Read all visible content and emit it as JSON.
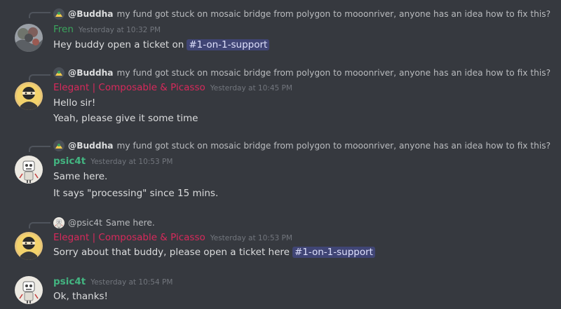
{
  "messages": [
    {
      "reply_to": "@Buddha",
      "reply_text": "my fund got stuck on mosaic bridge from polygon to mooonriver, anyone has an idea how to fix this?",
      "author": "Fren",
      "timestamp": "Yesterday at 10:32 PM",
      "lines": [
        "Hey buddy open a ticket on"
      ],
      "channel": "#1-on-1-support"
    },
    {
      "reply_to": "@Buddha",
      "reply_text": "my fund got stuck on mosaic bridge from polygon to mooonriver, anyone has an idea how to fix this?",
      "author": "Elegant | Composable & Picasso",
      "timestamp": "Yesterday at 10:45 PM",
      "lines": [
        "Hello sir!",
        "Yeah, please give it some time"
      ]
    },
    {
      "reply_to": "@Buddha",
      "reply_text": "my fund got stuck on mosaic bridge from polygon to mooonriver, anyone has an idea how to fix this?",
      "author": "psic4t",
      "timestamp": "Yesterday at 10:53 PM",
      "lines": [
        "Same here.",
        "It says \"processing\" since 15 mins."
      ]
    },
    {
      "reply_to": "@psic4t",
      "reply_text": "Same here.",
      "author": "Elegant | Composable & Picasso",
      "timestamp": "Yesterday at 10:53 PM",
      "lines": [
        "Sorry about that buddy, please open a ticket here"
      ],
      "channel": "#1-on-1-support"
    },
    {
      "author": "psic4t",
      "timestamp": "Yesterday at 10:54 PM",
      "lines": [
        "Ok, thanks!"
      ]
    }
  ],
  "colors": {
    "background": "#36393f",
    "fren": "#3ba55d",
    "elegant": "#d8295b",
    "psic4t": "#43b581",
    "mention_bg": "#3c4270"
  },
  "icons": {
    "reply_avatar": "avatar-icon",
    "fren_avatar": "tree-avatar",
    "elegant_avatar": "ninja-avatar",
    "psic4t_avatar": "robot-avatar"
  }
}
